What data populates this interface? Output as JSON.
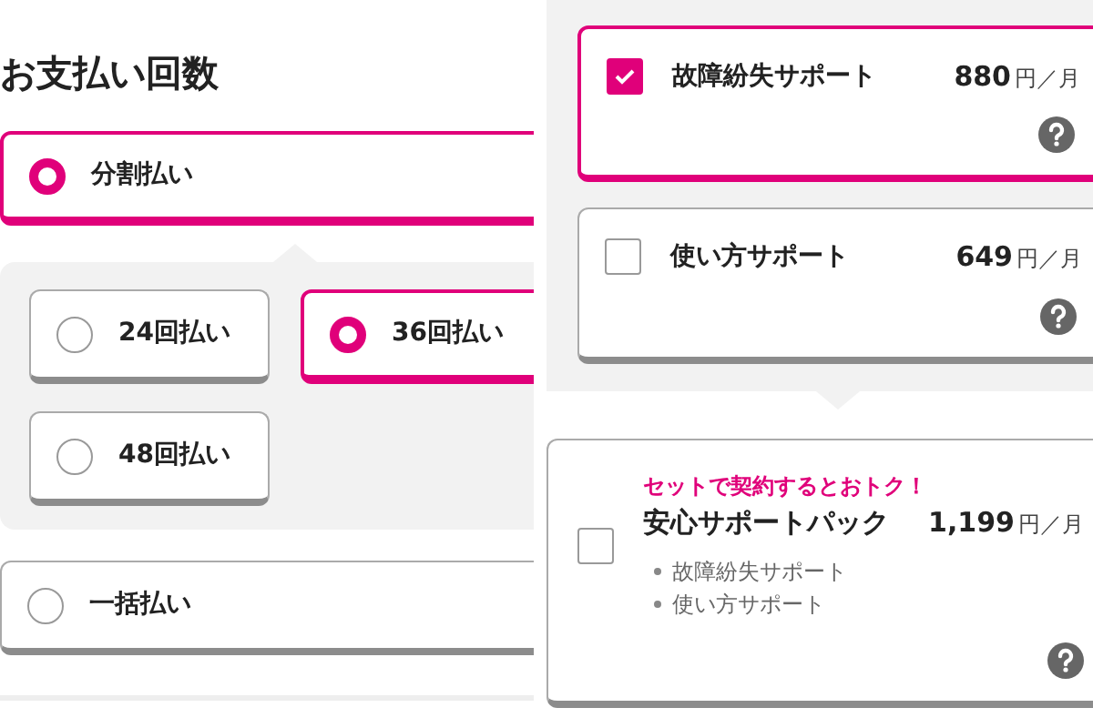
{
  "title": "お支払い回数",
  "payment_options": [
    {
      "label": "分割払い",
      "selected": true,
      "sub_options": [
        {
          "label": "24回払い",
          "selected": false
        },
        {
          "label": "36回払い",
          "selected": true
        },
        {
          "label": "48回払い",
          "selected": false
        }
      ]
    },
    {
      "label": "一括払い",
      "selected": false
    }
  ],
  "support_options": [
    {
      "name": "故障紛失サポート",
      "price": "880",
      "unit": "円／月",
      "checked": true
    },
    {
      "name": "使い方サポート",
      "price": "649",
      "unit": "円／月",
      "checked": false
    }
  ],
  "pack": {
    "promo": "セットで契約するとおトク！",
    "name": "安心サポートパック",
    "price": "1,199",
    "unit": "円／月",
    "checked": false,
    "items": [
      "故障紛失サポート",
      "使い方サポート"
    ]
  }
}
